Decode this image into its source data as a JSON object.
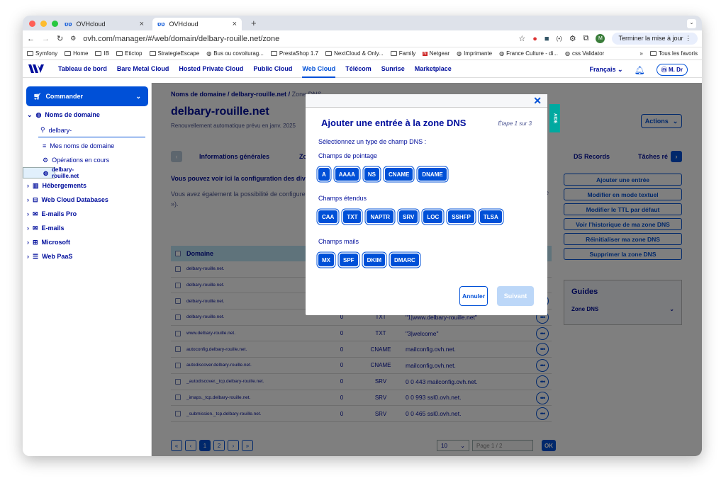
{
  "browser": {
    "tabs": [
      {
        "title": "OVHcloud"
      },
      {
        "title": "OVHcloud"
      }
    ],
    "url": "ovh.com/manager/#/web/domain/delbary-rouille.net/zone",
    "update_label": "Terminer la mise à jour",
    "bookmarks": [
      "Symfony",
      "Home",
      "IB",
      "Etictop",
      "StrategieEscape",
      "Bus ou covoiturag...",
      "PrestaShop 1.7",
      "NextCloud & Only...",
      "Family",
      "Netgear",
      "Imprimante",
      "France Culture - di...",
      "css Validator",
      "Tous les favoris"
    ],
    "profile_initial": "M"
  },
  "nav": {
    "items": [
      "Tableau de bord",
      "Bare Metal Cloud",
      "Hosted Private Cloud",
      "Public Cloud",
      "Web Cloud",
      "Télécom",
      "Sunrise",
      "Marketplace"
    ],
    "active": "Web Cloud",
    "language": "Français",
    "user": "M. Dr"
  },
  "sidebar": {
    "commander": "Commander",
    "domains": "Noms de domaine",
    "search_value": "delbary-",
    "my_domains": "Mes noms de domaine",
    "operations": "Opérations en cours",
    "selected": "delbary-rouille.net",
    "items": [
      "Hébergements",
      "Web Cloud Databases",
      "E-mails Pro",
      "E-mails",
      "Microsoft",
      "Web PaaS"
    ]
  },
  "page": {
    "crumb_1": "Noms de domaine",
    "crumb_2": "delbary-rouille.net",
    "crumb_3": "Zone DNS",
    "title": "delbary-rouille.net",
    "renewal": "Renouvellement automatique prévu en janv. 2025",
    "actions": "Actions",
    "help": "AIDE",
    "tabs": [
      "Informations générales",
      "Zone",
      "DS Records",
      "Tâches ré"
    ],
    "info_bold": "Vous pouvez voir ici la configuration des divers",
    "info_line1": "Vous avez également la possibilité de configurer c",
    "info_line2": "»).",
    "info_right": "e",
    "right_buttons": [
      "Ajouter une entrée",
      "Modifier en mode textuel",
      "Modifier le TTL par défaut",
      "Voir l'historique de ma zone DNS",
      "Réinitialiser ma zone DNS",
      "Supprimer la zone DNS"
    ],
    "guides_title": "Guides",
    "guides_item": "Zone DNS"
  },
  "table": {
    "header": "Domaine",
    "rows": [
      {
        "domain": "delbary-rouille.net.",
        "ttl": "",
        "type": "",
        "target": ""
      },
      {
        "domain": "delbary-rouille.net.",
        "ttl": "",
        "type": "",
        "target": ""
      },
      {
        "domain": "delbary-rouille.net.",
        "ttl": "",
        "type": "",
        "target": ""
      },
      {
        "domain": "delbary-rouille.net.",
        "ttl": "0",
        "type": "TXT",
        "target": "\"1|www.delbary-rouille.net\""
      },
      {
        "domain": "www.delbary-rouille.net.",
        "ttl": "0",
        "type": "TXT",
        "target": "\"3|welcome\""
      },
      {
        "domain": "autoconfig.delbary-rouille.net.",
        "ttl": "0",
        "type": "CNAME",
        "target": "mailconfig.ovh.net."
      },
      {
        "domain": "autodiscover.delbary-rouille.net.",
        "ttl": "0",
        "type": "CNAME",
        "target": "mailconfig.ovh.net."
      },
      {
        "domain": "_autodiscover._tcp.delbary-rouille.net.",
        "ttl": "0",
        "type": "SRV",
        "target": "0 0 443 mailconfig.ovh.net."
      },
      {
        "domain": "_imaps._tcp.delbary-rouille.net.",
        "ttl": "0",
        "type": "SRV",
        "target": "0 0 993 ssl0.ovh.net."
      },
      {
        "domain": "_submission._tcp.delbary-rouille.net.",
        "ttl": "0",
        "type": "SRV",
        "target": "0 0 465 ssl0.ovh.net."
      }
    ],
    "pages": [
      "1",
      "2"
    ],
    "page_size": "10",
    "page_input": "Page 1 / 2",
    "ok": "OK"
  },
  "modal": {
    "title": "Ajouter une entrée à la zone DNS",
    "step": "Étape 1 sur 3",
    "select_label": "Sélectionnez un type de champ DNS :",
    "groups": [
      {
        "label": "Champs de pointage",
        "types": [
          "A",
          "AAAA",
          "NS",
          "CNAME",
          "DNAME"
        ]
      },
      {
        "label": "Champs étendus",
        "types": [
          "CAA",
          "TXT",
          "NAPTR",
          "SRV",
          "LOC",
          "SSHFP",
          "TLSA"
        ]
      },
      {
        "label": "Champs mails",
        "types": [
          "MX",
          "SPF",
          "DKIM",
          "DMARC"
        ]
      }
    ],
    "cancel": "Annuler",
    "next": "Suivant"
  }
}
